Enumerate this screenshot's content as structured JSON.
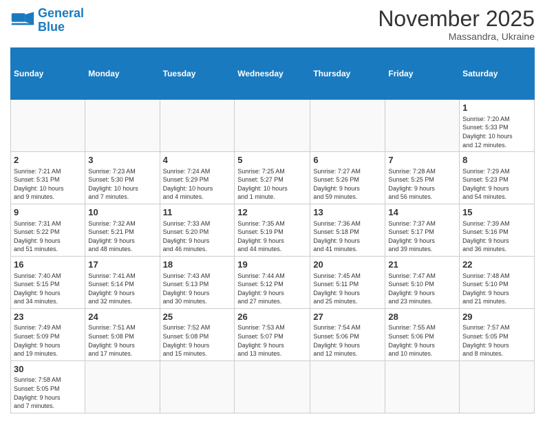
{
  "header": {
    "logo_general": "General",
    "logo_blue": "Blue",
    "month": "November 2025",
    "location": "Massandra, Ukraine"
  },
  "days_of_week": [
    "Sunday",
    "Monday",
    "Tuesday",
    "Wednesday",
    "Thursday",
    "Friday",
    "Saturday"
  ],
  "weeks": [
    [
      {
        "num": "",
        "info": ""
      },
      {
        "num": "",
        "info": ""
      },
      {
        "num": "",
        "info": ""
      },
      {
        "num": "",
        "info": ""
      },
      {
        "num": "",
        "info": ""
      },
      {
        "num": "",
        "info": ""
      },
      {
        "num": "1",
        "info": "Sunrise: 7:20 AM\nSunset: 5:33 PM\nDaylight: 10 hours\nand 12 minutes."
      }
    ],
    [
      {
        "num": "2",
        "info": "Sunrise: 7:21 AM\nSunset: 5:31 PM\nDaylight: 10 hours\nand 9 minutes."
      },
      {
        "num": "3",
        "info": "Sunrise: 7:23 AM\nSunset: 5:30 PM\nDaylight: 10 hours\nand 7 minutes."
      },
      {
        "num": "4",
        "info": "Sunrise: 7:24 AM\nSunset: 5:29 PM\nDaylight: 10 hours\nand 4 minutes."
      },
      {
        "num": "5",
        "info": "Sunrise: 7:25 AM\nSunset: 5:27 PM\nDaylight: 10 hours\nand 1 minute."
      },
      {
        "num": "6",
        "info": "Sunrise: 7:27 AM\nSunset: 5:26 PM\nDaylight: 9 hours\nand 59 minutes."
      },
      {
        "num": "7",
        "info": "Sunrise: 7:28 AM\nSunset: 5:25 PM\nDaylight: 9 hours\nand 56 minutes."
      },
      {
        "num": "8",
        "info": "Sunrise: 7:29 AM\nSunset: 5:23 PM\nDaylight: 9 hours\nand 54 minutes."
      }
    ],
    [
      {
        "num": "9",
        "info": "Sunrise: 7:31 AM\nSunset: 5:22 PM\nDaylight: 9 hours\nand 51 minutes."
      },
      {
        "num": "10",
        "info": "Sunrise: 7:32 AM\nSunset: 5:21 PM\nDaylight: 9 hours\nand 48 minutes."
      },
      {
        "num": "11",
        "info": "Sunrise: 7:33 AM\nSunset: 5:20 PM\nDaylight: 9 hours\nand 46 minutes."
      },
      {
        "num": "12",
        "info": "Sunrise: 7:35 AM\nSunset: 5:19 PM\nDaylight: 9 hours\nand 44 minutes."
      },
      {
        "num": "13",
        "info": "Sunrise: 7:36 AM\nSunset: 5:18 PM\nDaylight: 9 hours\nand 41 minutes."
      },
      {
        "num": "14",
        "info": "Sunrise: 7:37 AM\nSunset: 5:17 PM\nDaylight: 9 hours\nand 39 minutes."
      },
      {
        "num": "15",
        "info": "Sunrise: 7:39 AM\nSunset: 5:16 PM\nDaylight: 9 hours\nand 36 minutes."
      }
    ],
    [
      {
        "num": "16",
        "info": "Sunrise: 7:40 AM\nSunset: 5:15 PM\nDaylight: 9 hours\nand 34 minutes."
      },
      {
        "num": "17",
        "info": "Sunrise: 7:41 AM\nSunset: 5:14 PM\nDaylight: 9 hours\nand 32 minutes."
      },
      {
        "num": "18",
        "info": "Sunrise: 7:43 AM\nSunset: 5:13 PM\nDaylight: 9 hours\nand 30 minutes."
      },
      {
        "num": "19",
        "info": "Sunrise: 7:44 AM\nSunset: 5:12 PM\nDaylight: 9 hours\nand 27 minutes."
      },
      {
        "num": "20",
        "info": "Sunrise: 7:45 AM\nSunset: 5:11 PM\nDaylight: 9 hours\nand 25 minutes."
      },
      {
        "num": "21",
        "info": "Sunrise: 7:47 AM\nSunset: 5:10 PM\nDaylight: 9 hours\nand 23 minutes."
      },
      {
        "num": "22",
        "info": "Sunrise: 7:48 AM\nSunset: 5:10 PM\nDaylight: 9 hours\nand 21 minutes."
      }
    ],
    [
      {
        "num": "23",
        "info": "Sunrise: 7:49 AM\nSunset: 5:09 PM\nDaylight: 9 hours\nand 19 minutes."
      },
      {
        "num": "24",
        "info": "Sunrise: 7:51 AM\nSunset: 5:08 PM\nDaylight: 9 hours\nand 17 minutes."
      },
      {
        "num": "25",
        "info": "Sunrise: 7:52 AM\nSunset: 5:08 PM\nDaylight: 9 hours\nand 15 minutes."
      },
      {
        "num": "26",
        "info": "Sunrise: 7:53 AM\nSunset: 5:07 PM\nDaylight: 9 hours\nand 13 minutes."
      },
      {
        "num": "27",
        "info": "Sunrise: 7:54 AM\nSunset: 5:06 PM\nDaylight: 9 hours\nand 12 minutes."
      },
      {
        "num": "28",
        "info": "Sunrise: 7:55 AM\nSunset: 5:06 PM\nDaylight: 9 hours\nand 10 minutes."
      },
      {
        "num": "29",
        "info": "Sunrise: 7:57 AM\nSunset: 5:05 PM\nDaylight: 9 hours\nand 8 minutes."
      }
    ],
    [
      {
        "num": "30",
        "info": "Sunrise: 7:58 AM\nSunset: 5:05 PM\nDaylight: 9 hours\nand 7 minutes."
      },
      {
        "num": "",
        "info": ""
      },
      {
        "num": "",
        "info": ""
      },
      {
        "num": "",
        "info": ""
      },
      {
        "num": "",
        "info": ""
      },
      {
        "num": "",
        "info": ""
      },
      {
        "num": "",
        "info": ""
      }
    ]
  ]
}
